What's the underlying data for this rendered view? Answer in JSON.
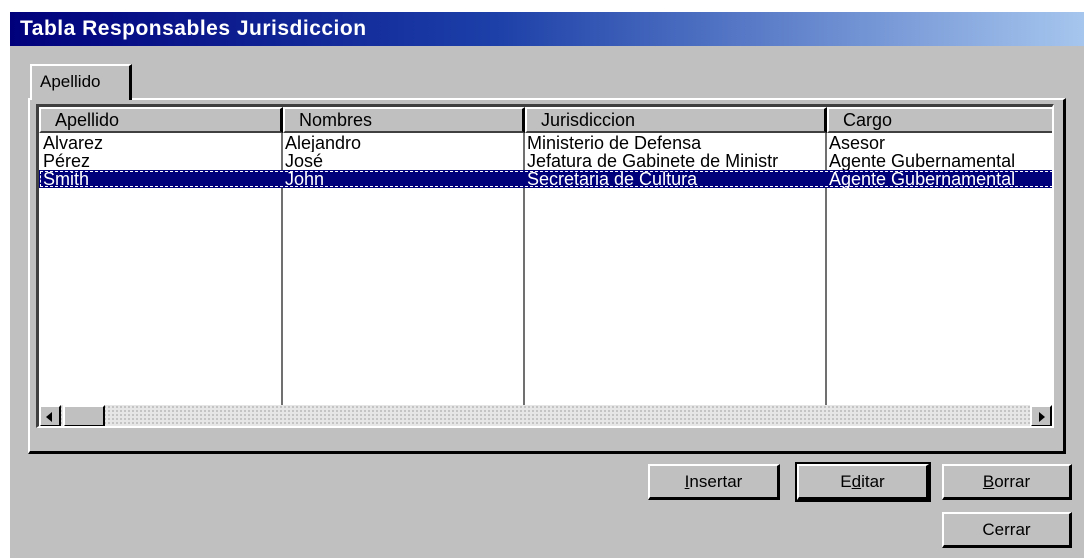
{
  "window": {
    "title": "Tabla Responsables Jurisdiccion"
  },
  "tabs": [
    {
      "label": "Apellido"
    }
  ],
  "grid": {
    "columns": [
      "Apellido",
      "Nombres",
      "Jurisdiccion",
      "Cargo"
    ],
    "rows": [
      {
        "apellido": "Alvarez",
        "nombres": "Alejandro",
        "jurisdiccion": "Ministerio de Defensa",
        "cargo": "Asesor"
      },
      {
        "apellido": "Pérez",
        "nombres": "José",
        "jurisdiccion": "Jefatura de Gabinete de Ministr",
        "cargo": "Agente Gubernamental"
      },
      {
        "apellido": "Smith",
        "nombres": "John",
        "jurisdiccion": "Secretaria de Cultura",
        "cargo": "Agente Gubernamental"
      }
    ],
    "selected_row": 3
  },
  "buttons": {
    "insertar": {
      "mnemonic": "I",
      "rest": "nsertar"
    },
    "editar": {
      "first": "E",
      "mnemonic": "d",
      "rest": "itar"
    },
    "borrar": {
      "mnemonic": "B",
      "rest": "orrar"
    },
    "cerrar": {
      "label": "Cerrar"
    }
  },
  "colors": {
    "selection": "#00007b",
    "face": "#c0c0c0",
    "title_start": "#00007b",
    "title_end": "#a6c6ee"
  }
}
